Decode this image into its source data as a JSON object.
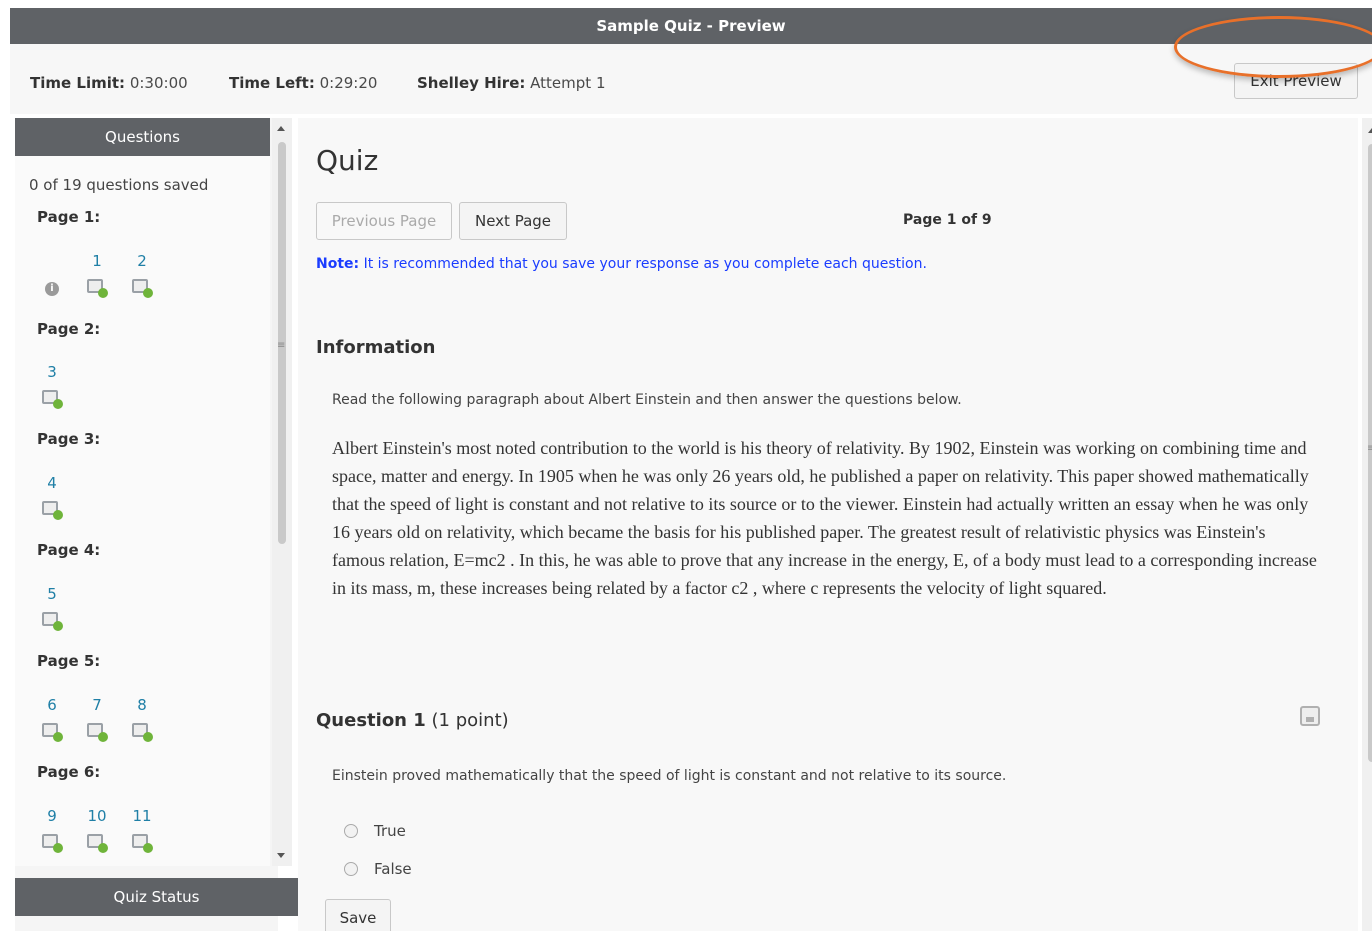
{
  "titlebar": {
    "title": "Sample Quiz - Preview"
  },
  "infobar": {
    "time_limit_label": "Time Limit:",
    "time_limit_value": "0:30:00",
    "time_left_label": "Time Left:",
    "time_left_value": "0:29:20",
    "user_label": "Shelley Hire:",
    "user_value": "Attempt 1",
    "exit_label": "Exit Preview",
    "highlight_color": "#e8702a"
  },
  "sidebar": {
    "header": "Questions",
    "saved_count": "0 of 19 questions saved",
    "pages": [
      {
        "label": "Page 1:",
        "questions": [
          "1",
          "2"
        ],
        "has_info": true
      },
      {
        "label": "Page 2:",
        "questions": [
          "3"
        ]
      },
      {
        "label": "Page 3:",
        "questions": [
          "4"
        ]
      },
      {
        "label": "Page 4:",
        "questions": [
          "5"
        ]
      },
      {
        "label": "Page 5:",
        "questions": [
          "6",
          "7",
          "8"
        ]
      },
      {
        "label": "Page 6:",
        "questions": [
          "9",
          "10",
          "11"
        ]
      }
    ],
    "status_header": "Quiz Status"
  },
  "main": {
    "title": "Quiz",
    "prev_label": "Previous Page",
    "next_label": "Next Page",
    "page_indicator": "Page 1 of 9",
    "note_label": "Note:",
    "note_text": " It is recommended that you save your response as you complete each question.",
    "info_heading": "Information",
    "instruction": "Read the following paragraph about Albert Einstein and then answer the questions below.",
    "paragraph": "Albert Einstein's most noted contribution to the world is his theory of relativity. By 1902, Einstein was working on combining time and space, matter and energy. In 1905 when he was only 26 years old, he published a paper on relativity. This paper showed mathematically that the speed of light is constant and not relative to its source or to the viewer. Einstein had actually written an essay when he was only 16 years old on relativity, which became the basis for his published paper. The greatest result of relativistic physics was Einstein's famous relation, E=mc2 . In this, he was able to prove that any increase in the energy, E, of a body must lead to a corresponding increase in its mass, m, these increases being related by a factor c2 , where c represents the velocity of light squared.",
    "question": {
      "title": "Question 1",
      "points": " (1 point)",
      "text": "Einstein proved mathematically that the speed of light is constant and not relative to its source.",
      "options": [
        "True",
        "False"
      ],
      "save_label": "Save"
    }
  }
}
